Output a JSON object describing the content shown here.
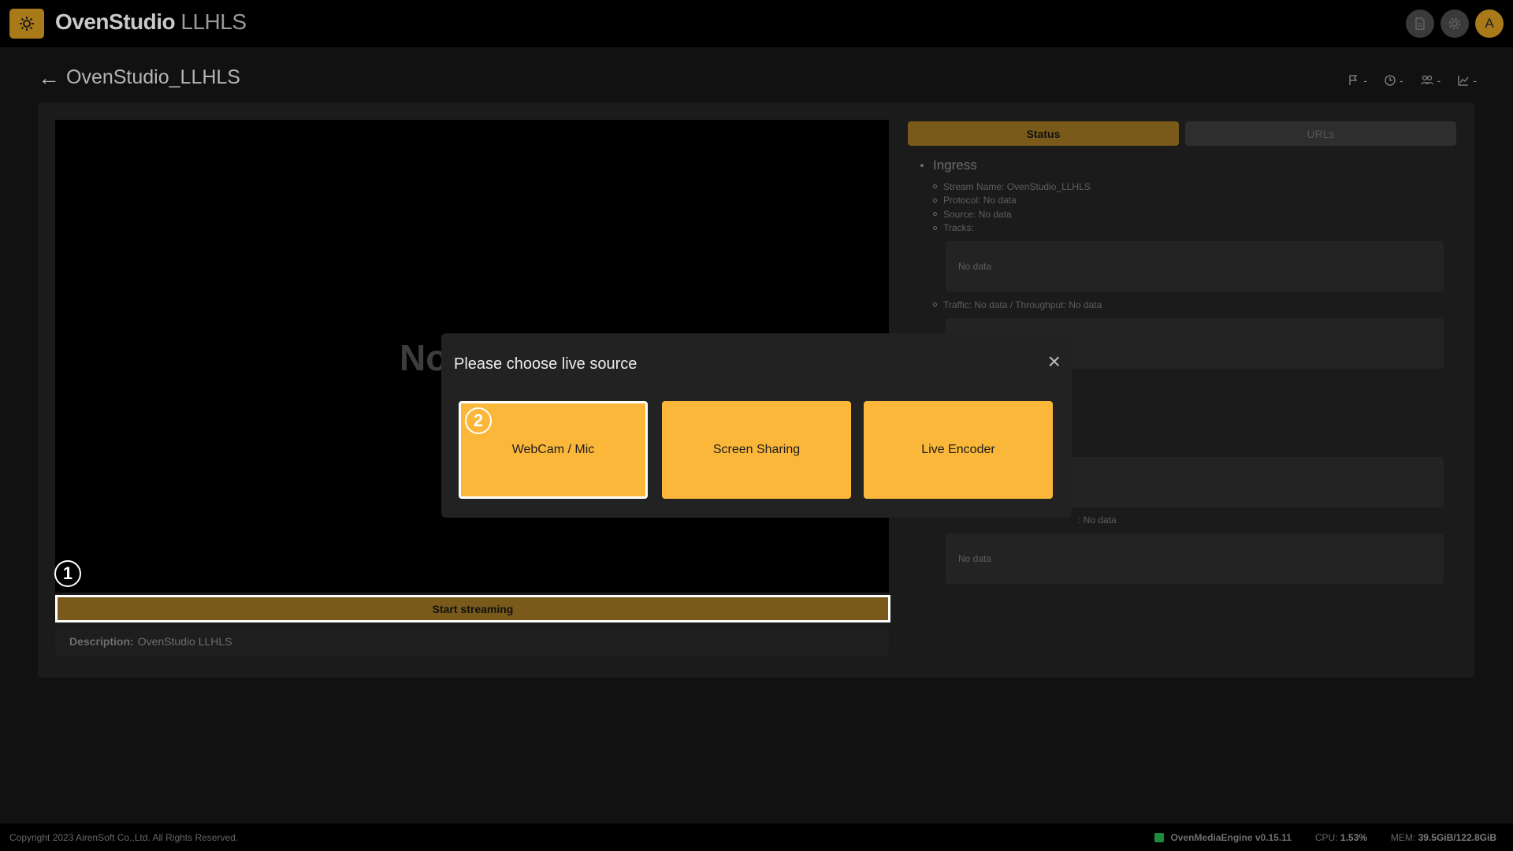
{
  "app": {
    "brand_bold": "OvenStudio",
    "brand_light": "LLHLS",
    "avatar_letter": "A"
  },
  "page": {
    "title": "OvenStudio_LLHLS",
    "stats": [
      {
        "icon": "flag-icon",
        "value": "-"
      },
      {
        "icon": "clock-icon",
        "value": "-"
      },
      {
        "icon": "users-icon",
        "value": "-"
      },
      {
        "icon": "chart-icon",
        "value": "-"
      }
    ]
  },
  "player": {
    "overlay_text": "No",
    "start_button": "Start streaming",
    "description_label": "Description:",
    "description_value": "OvenStudio LLHLS"
  },
  "markers": {
    "one": "1",
    "two": "2"
  },
  "tabs": {
    "status": "Status",
    "urls": "URLs"
  },
  "ingress": {
    "title": "Ingress",
    "stream_name": "Stream Name: OvenStudio_LLHLS",
    "protocol": "Protocol: No data",
    "source": "Source: No data",
    "tracks": "Tracks:",
    "tracks_box": "No data",
    "traffic": "Traffic: No data / Throughput: No data",
    "partial_value": ": No data",
    "last_box": "No data"
  },
  "modal": {
    "title": "Please choose live source",
    "close": "×",
    "options": [
      "WebCam / Mic",
      "Screen Sharing",
      "Live Encoder"
    ]
  },
  "footer": {
    "copyright": "Copyright 2023 AirenSoft Co.,Ltd. All Rights Reserved.",
    "engine": "OvenMediaEngine v0.15.11",
    "cpu_label": "CPU:",
    "cpu_value": "1.53%",
    "mem_label": "MEM:",
    "mem_value": "39.5GiB/122.8GiB"
  },
  "colors": {
    "accent": "#fbb73a",
    "accent_dim": "#7a5a1a",
    "status_ok": "#1e8c3a"
  }
}
